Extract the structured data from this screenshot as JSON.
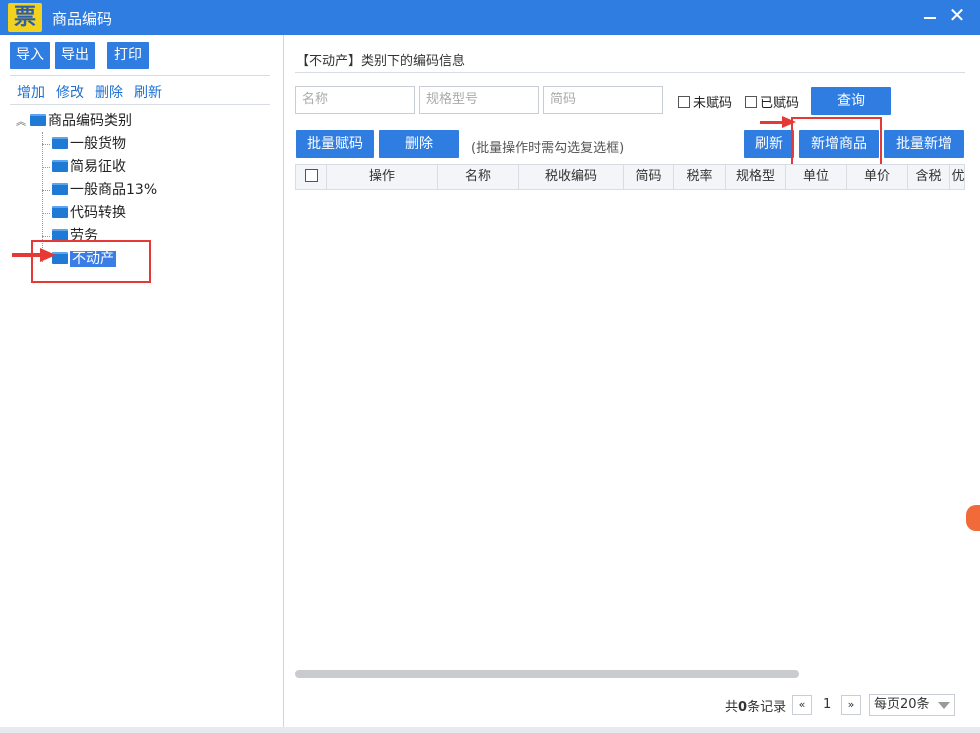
{
  "window": {
    "logo_glyph": "票",
    "title": "商品编码"
  },
  "left": {
    "toolbar": {
      "import": "导入",
      "export": "导出",
      "print": "打印"
    },
    "actions": {
      "add": "增加",
      "edit": "修改",
      "delete": "删除",
      "refresh": "刷新"
    },
    "tree": {
      "root": "商品编码类别",
      "items": [
        "一般货物",
        "简易征收",
        "一般商品13%",
        "代码转换",
        "劳务",
        "不动产"
      ],
      "selected": "不动产"
    }
  },
  "right": {
    "title": "【不动产】类别下的编码信息",
    "search": {
      "name_placeholder": "名称",
      "spec_placeholder": "规格型号",
      "short_code_placeholder": "简码"
    },
    "filters": {
      "unassigned": "未赋码",
      "assigned": "已赋码"
    },
    "query": "查询",
    "toolbar": {
      "batch_assign": "批量赋码",
      "delete": "删除",
      "hint": "(批量操作时需勾选复选框)",
      "refresh": "刷新",
      "new_product": "新增商品",
      "batch_add": "批量新增"
    },
    "columns": [
      "操作",
      "名称",
      "税收编码",
      "简码",
      "税率",
      "规格型",
      "单位",
      "单价",
      "含税",
      "优"
    ]
  },
  "pager": {
    "total_prefix": "共",
    "total_count": "0",
    "total_suffix": "条记录",
    "prev": "«",
    "page": "1",
    "next": "»",
    "page_size": "每页20条"
  },
  "colors": {
    "accent": "#2f7de1",
    "annotation_red": "#e53935"
  }
}
